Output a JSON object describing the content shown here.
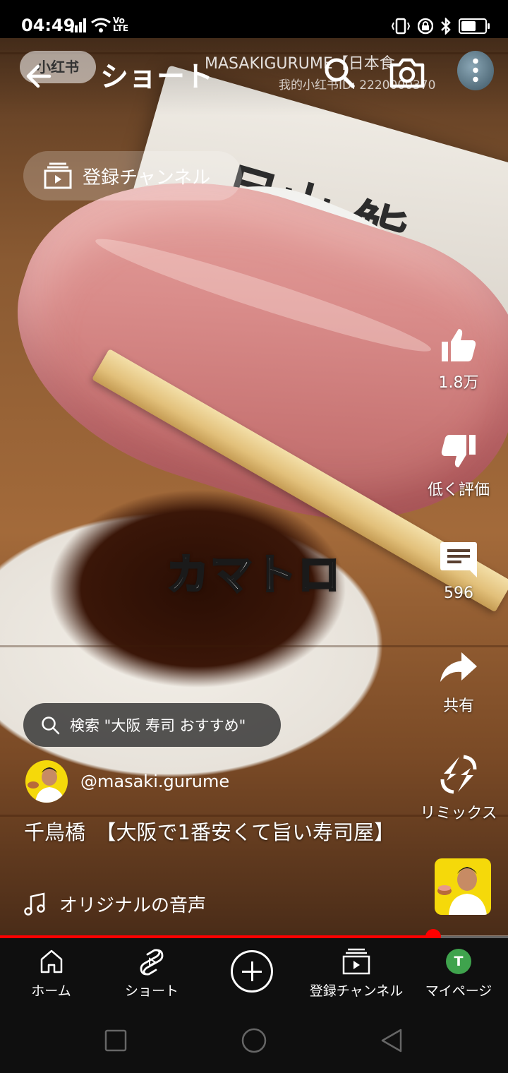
{
  "status_bar": {
    "time": "04:49",
    "network": "LTE",
    "network_top": "Vo",
    "right_icons": [
      "vibrate-icon",
      "lock-icon",
      "bluetooth-icon",
      "battery-icon"
    ]
  },
  "watermark": {
    "badge": "小红书",
    "title": "MASAKIGURUME【日本食",
    "subtitle": "我的小红书ID: 2220000370"
  },
  "header": {
    "title": "ショート",
    "back_icon": "back-arrow-icon",
    "search_icon": "search-icon",
    "camera_icon": "camera-icon",
    "menu_icon": "more-vert-icon"
  },
  "subscriptions_chip": {
    "label": "登録チャンネル"
  },
  "video": {
    "caption_overlay": "カマトロ"
  },
  "actions": {
    "like": {
      "count": "1.8万"
    },
    "dislike": {
      "label": "低く評価"
    },
    "comments": {
      "count": "596"
    },
    "share": {
      "label": "共有"
    },
    "remix": {
      "label": "リミックス"
    }
  },
  "search_suggestion": {
    "text": "検索 \"大阪 寿司 おすすめ\""
  },
  "channel": {
    "handle": "@masaki.gurume"
  },
  "video_title": "千鳥橋　【大阪で1番安くて旨い寿司屋】",
  "sound": {
    "label": "オリジナルの音声"
  },
  "progress": {
    "fraction": 0.853
  },
  "bottom_nav": {
    "home": "ホーム",
    "shorts": "ショート",
    "subscriptions": "登録チャンネル",
    "you": "マイページ",
    "avatar_letter": "T"
  },
  "colors": {
    "progress": "#ff0000",
    "avatar_bg": "#3fa34d",
    "thumb_bg": "#f5d90a"
  }
}
